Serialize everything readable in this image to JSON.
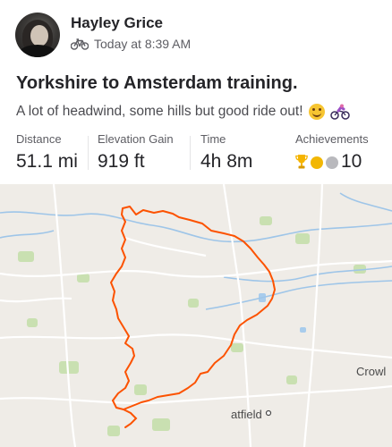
{
  "athlete": {
    "name": "Hayley Grice"
  },
  "activity": {
    "type_icon": "bicycle-icon",
    "timestamp": "Today at 8:39 AM",
    "title": "Yorkshire to Amsterdam training.",
    "description": "A lot of headwind, some hills but good ride out!",
    "description_emojis": [
      "smiling-face-icon",
      "person-mountain-biking-icon"
    ]
  },
  "stats": [
    {
      "label": "Distance",
      "value": "51.1 mi"
    },
    {
      "label": "Elevation Gain",
      "value": "919 ft"
    },
    {
      "label": "Time",
      "value": "4h 8m"
    },
    {
      "label": "Achievements",
      "value": "10",
      "icons": [
        "trophy-icon",
        "gold-medal-icon",
        "silver-medal-icon"
      ]
    }
  ],
  "map": {
    "labels": {
      "town_right": "Crowl",
      "town_bottom": "atfield"
    },
    "route_color": "#fc5200"
  }
}
